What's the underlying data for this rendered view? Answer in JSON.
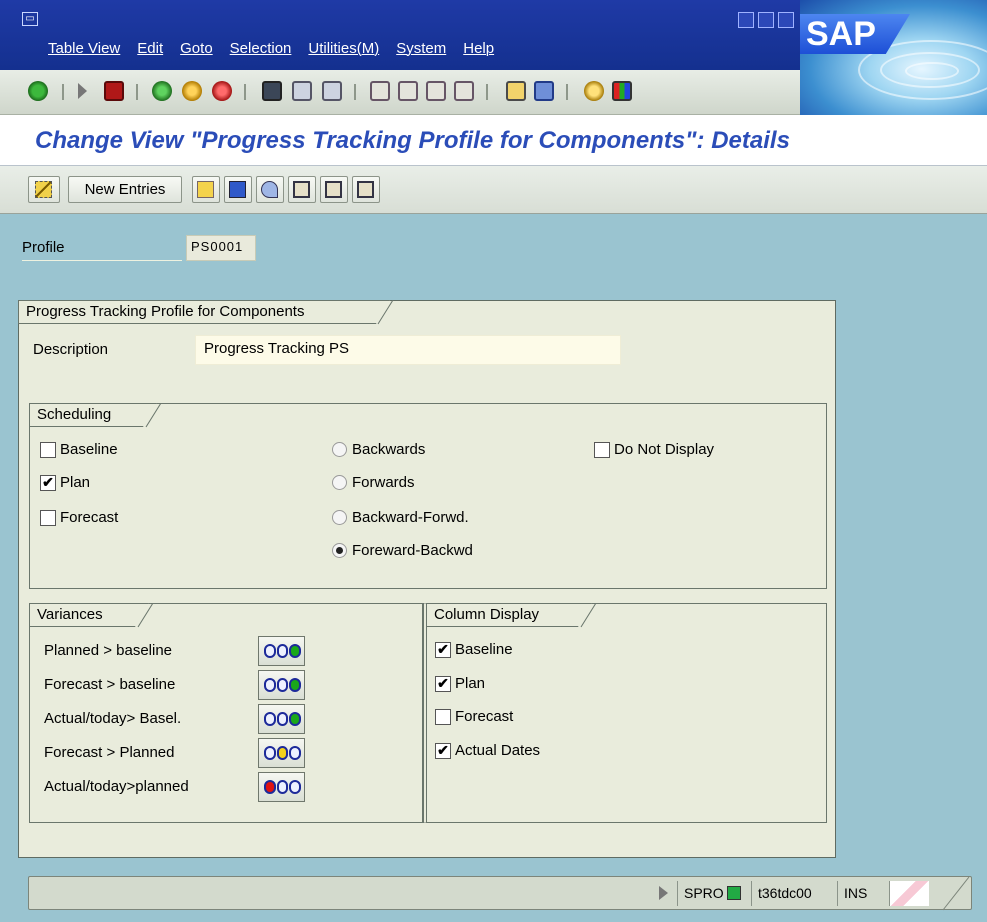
{
  "menu": {
    "items": [
      "Table View",
      "Edit",
      "Goto",
      "Selection",
      "Utilities(M)",
      "System",
      "Help"
    ]
  },
  "brand": {
    "logo_text": "SAP"
  },
  "toolbar_icons": [
    "enter-icon",
    "back-icon",
    "save-icon",
    "back-nav-icon",
    "exit-icon",
    "cancel-icon",
    "print-icon",
    "find-icon",
    "find-next-icon",
    "first-page-icon",
    "prev-page-icon",
    "next-page-icon",
    "last-page-icon",
    "create-session-icon",
    "shortcut-icon",
    "help-icon",
    "layout-icon"
  ],
  "title": "Change View \"Progress Tracking Profile for Components\": Details",
  "app_toolbar": {
    "new_entries_label": "New Entries",
    "icons": [
      "edit-display-icon",
      "copy-icon",
      "delete-icon",
      "undo-icon",
      "prev-entry-icon",
      "next-entry-icon",
      "select-icon"
    ]
  },
  "profile": {
    "label": "Profile",
    "value": "PS0001"
  },
  "main_group": {
    "title": "Progress Tracking Profile for Components",
    "description_label": "Description",
    "description_value": "Progress Tracking PS"
  },
  "scheduling": {
    "title": "Scheduling",
    "checkboxes": [
      {
        "label": "Baseline",
        "checked": false
      },
      {
        "label": "Plan",
        "checked": true
      },
      {
        "label": "Forecast",
        "checked": false
      }
    ],
    "radios": [
      {
        "label": "Backwards",
        "selected": false
      },
      {
        "label": "Forwards",
        "selected": false
      },
      {
        "label": "Backward-Forwd.",
        "selected": false
      },
      {
        "label": "Foreward-Backwd",
        "selected": true
      }
    ],
    "do_not_display": {
      "label": "Do Not Display",
      "checked": false
    }
  },
  "variances": {
    "title": "Variances",
    "rows": [
      {
        "label": "Planned > baseline",
        "light": "green"
      },
      {
        "label": "Forecast > baseline",
        "light": "green"
      },
      {
        "label": "Actual/today> Basel.",
        "light": "green"
      },
      {
        "label": "Forecast > Planned",
        "light": "yellow"
      },
      {
        "label": "Actual/today>planned",
        "light": "red"
      }
    ]
  },
  "column_display": {
    "title": "Column Display",
    "items": [
      {
        "label": "Baseline",
        "checked": true
      },
      {
        "label": "Plan",
        "checked": true
      },
      {
        "label": "Forecast",
        "checked": false
      },
      {
        "label": "Actual Dates",
        "checked": true
      }
    ]
  },
  "status": {
    "transaction": "SPRO",
    "server": "t36tdc00",
    "mode": "INS"
  },
  "colors": {
    "title_blue": "#2b4db8",
    "menu_blue": "#1f3aa6",
    "content_bg": "#9ac4d0",
    "panel_bg": "#e9ecdc",
    "light_green": "#1aa81a",
    "light_yellow": "#f3d21b",
    "light_red": "#e01212"
  }
}
